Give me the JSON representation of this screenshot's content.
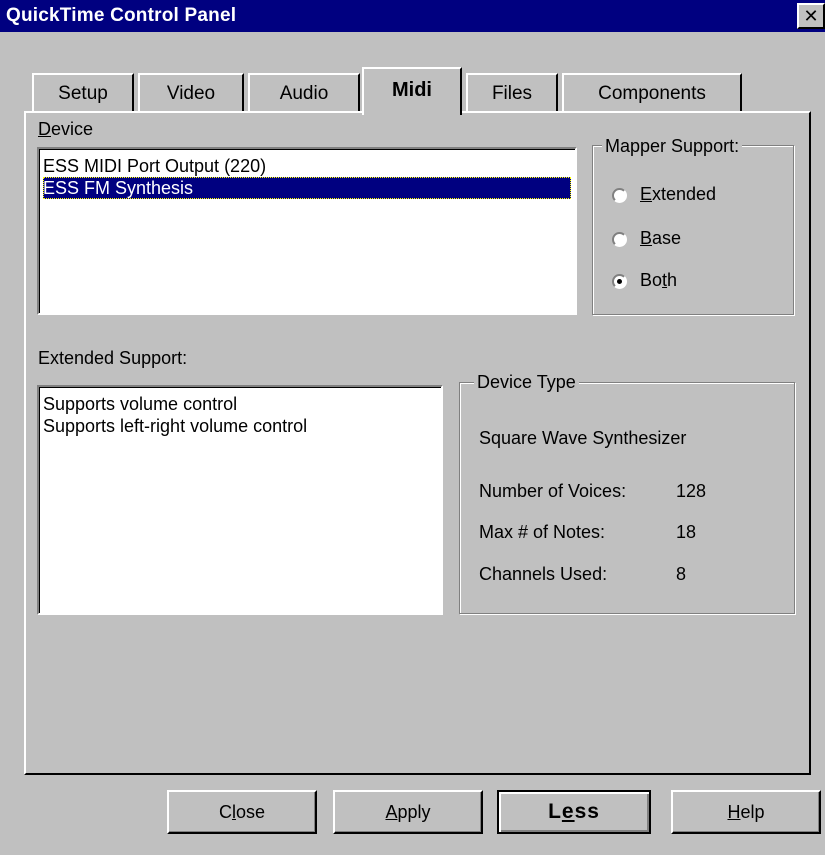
{
  "window": {
    "title": "QuickTime Control Panel",
    "close_glyph": "✕"
  },
  "tabs": [
    {
      "label": "Setup",
      "active": false
    },
    {
      "label": "Video",
      "active": false
    },
    {
      "label": "Audio",
      "active": false
    },
    {
      "label": "Midi",
      "active": true
    },
    {
      "label": "Files",
      "active": false
    },
    {
      "label": "Components",
      "active": false
    }
  ],
  "device": {
    "label_first": "D",
    "label_rest": "evice",
    "items": [
      {
        "label": "ESS MIDI Port Output (220)",
        "selected": false
      },
      {
        "label": "ESS FM Synthesis",
        "selected": true
      }
    ]
  },
  "mapper_support": {
    "title": "Mapper Support:",
    "options": [
      {
        "accel": "E",
        "rest": "xtended",
        "selected": false
      },
      {
        "accel": "B",
        "rest": "ase",
        "selected": false
      },
      {
        "pre": "Bo",
        "accel": "t",
        "rest": "h",
        "selected": true
      }
    ]
  },
  "extended_support": {
    "label": "Extended Support:",
    "items": [
      "Supports volume control",
      "Supports left-right volume control"
    ]
  },
  "device_type": {
    "title": "Device Type",
    "name": "Square Wave Synthesizer",
    "stats": [
      {
        "label": "Number of Voices:",
        "value": "128"
      },
      {
        "label": "Max # of Notes:",
        "value": "18"
      },
      {
        "label": "Channels Used:",
        "value": "8"
      }
    ]
  },
  "buttons": {
    "close": {
      "pre": "C",
      "accel": "l",
      "rest": "ose"
    },
    "apply": {
      "pre": "",
      "accel": "A",
      "rest": "pply"
    },
    "less": {
      "pre": "L",
      "accel": "e",
      "rest": "ss"
    },
    "help": {
      "pre": "",
      "accel": "H",
      "rest": "elp"
    }
  },
  "colors": {
    "titlebar": "#000080",
    "face": "#c0c0c0",
    "selection": "#000080"
  }
}
